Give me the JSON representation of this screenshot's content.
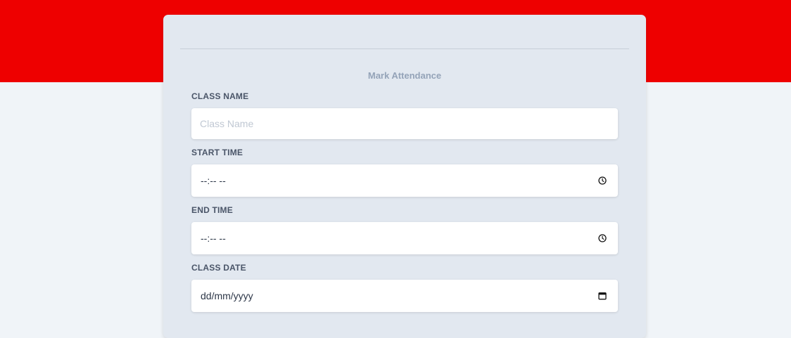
{
  "form": {
    "title": "Mark Attendance",
    "fields": {
      "class_name": {
        "label": "CLASS NAME",
        "placeholder": "Class Name",
        "value": ""
      },
      "start_time": {
        "label": "START TIME",
        "value": "--:-- --",
        "icon": "clock-icon"
      },
      "end_time": {
        "label": "END TIME",
        "value": "--:-- --",
        "icon": "clock-icon"
      },
      "class_date": {
        "label": "CLASS DATE",
        "value": "dd/mm/yyyy",
        "icon": "calendar-icon"
      }
    }
  },
  "colors": {
    "header_band": "#ee0000",
    "page_background": "#f0f4f8",
    "card_background": "#e2e8f0",
    "label_text": "#4a5568",
    "title_text": "#94a3b8"
  }
}
